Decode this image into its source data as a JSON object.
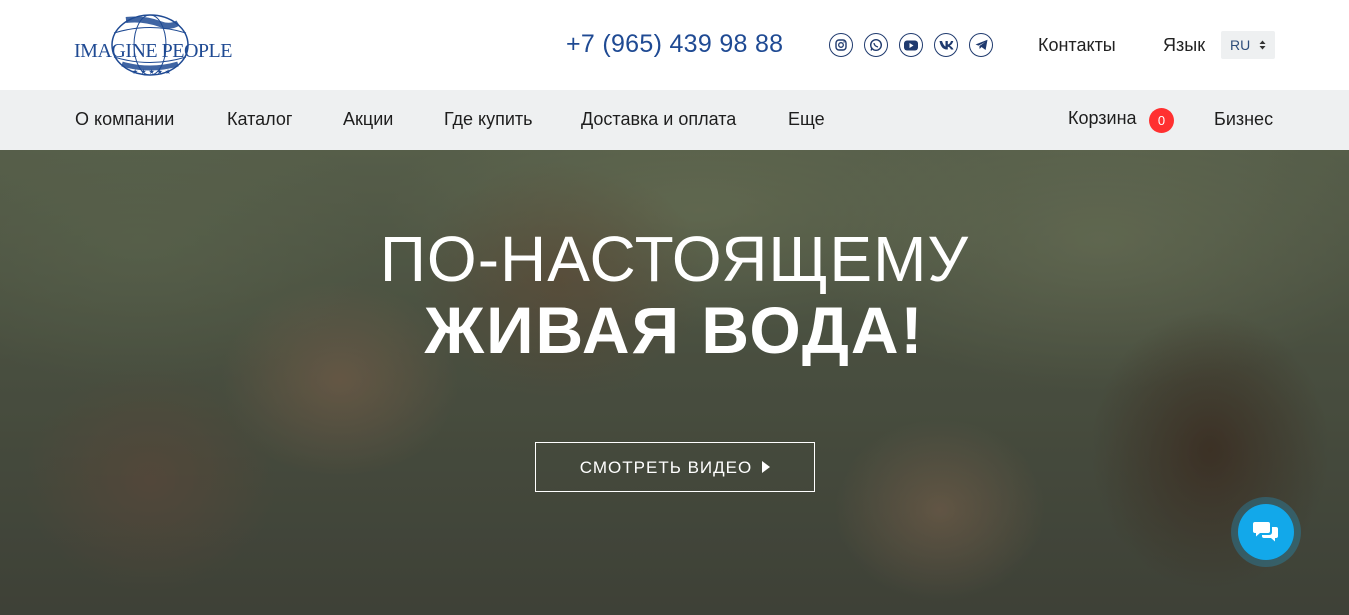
{
  "header": {
    "logo_text": "IMAGINE PEOPLE",
    "phone": "+7 (965) 439 98 88",
    "socials": [
      "instagram-icon",
      "whatsapp-icon",
      "youtube-icon",
      "vk-icon",
      "telegram-icon"
    ],
    "contacts_label": "Контакты",
    "language_label": "Язык",
    "language_value": "RU"
  },
  "nav": {
    "items": [
      "О компании",
      "Каталог",
      "Акции",
      "Где купить",
      "Доставка и оплата",
      "Еще"
    ],
    "cart_label": "Корзина",
    "cart_count": "0",
    "business_label": "Бизнес"
  },
  "hero": {
    "title_line1": "ПО-НАСТОЯЩЕМУ",
    "title_line2": "ЖИВАЯ ВОДА!",
    "button_label": "СМОТРЕТЬ ВИДЕО"
  },
  "chat": {
    "icon": "chat-icon"
  },
  "colors": {
    "brand_blue": "#1f4a93",
    "nav_background": "#eef0f1",
    "badge_red": "#ff3030",
    "chat_blue": "#12a8ea"
  }
}
